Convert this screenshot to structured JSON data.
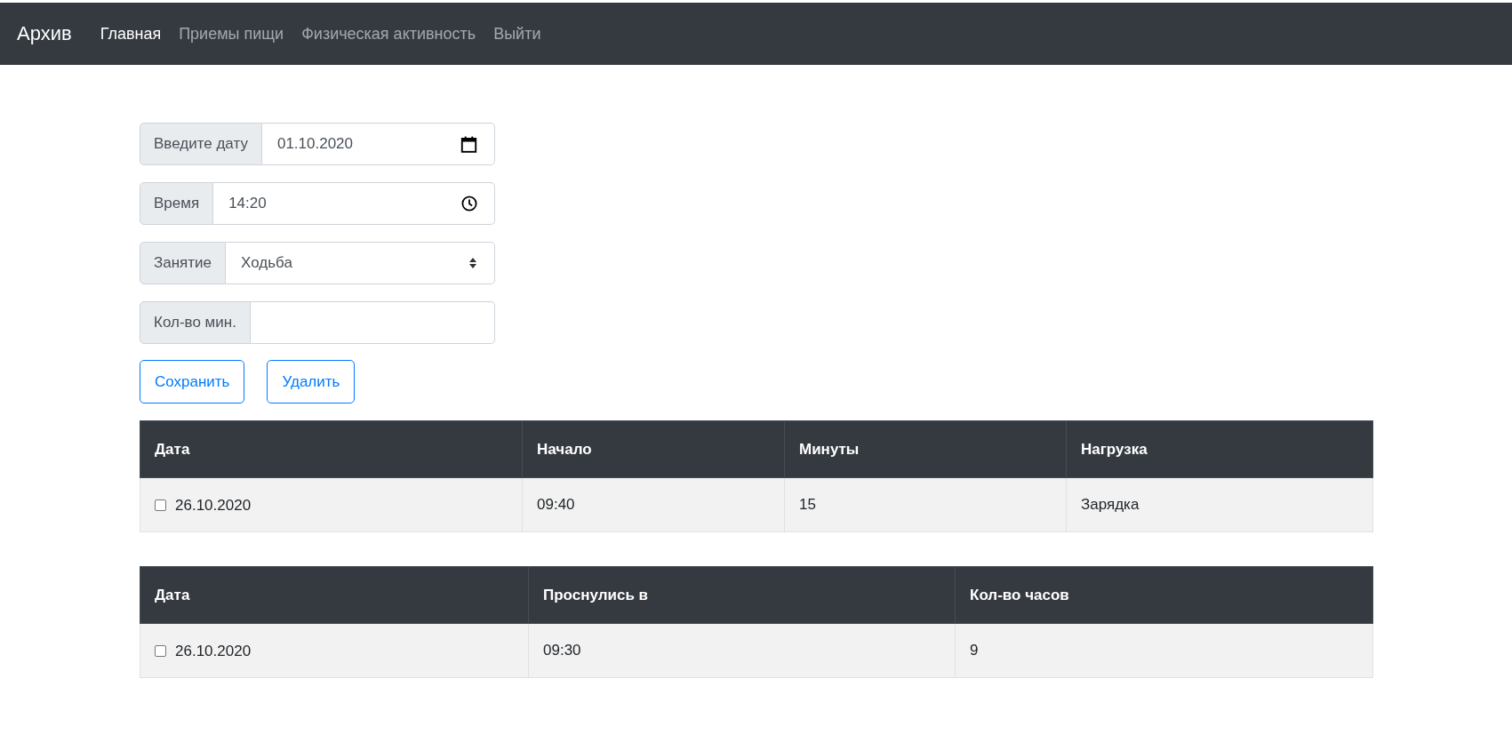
{
  "navbar": {
    "brand": "Архив",
    "items": [
      {
        "label": "Главная",
        "selected": true
      },
      {
        "label": "Приемы пищи",
        "selected": false
      },
      {
        "label": "Физическая активность",
        "selected": false
      },
      {
        "label": "Выйти",
        "selected": false
      }
    ]
  },
  "form": {
    "fields": [
      {
        "kind": "date",
        "label": "Введите дату",
        "value": "01.10.2020"
      },
      {
        "kind": "time",
        "label": "Время",
        "value": "14:20"
      },
      {
        "kind": "select",
        "label": "Занятие",
        "value": "Ходьба"
      },
      {
        "kind": "number",
        "label": "Кол-во мин."
      }
    ],
    "buttons": [
      "Сохранить",
      "Удалить"
    ]
  },
  "tables": [
    {
      "columns": [
        "Дата",
        "Начало",
        "Минуты",
        "Нагрузка"
      ],
      "rows": [
        {
          "checked": false,
          "cells": [
            "26.10.2020",
            "09:40",
            "15",
            "Зарядка"
          ]
        }
      ]
    },
    {
      "columns": [
        "Дата",
        "Проснулись в",
        "Кол-во часов"
      ],
      "rows": [
        {
          "checked": false,
          "cells": [
            "26.10.2020",
            "09:30",
            "9"
          ]
        }
      ]
    }
  ]
}
